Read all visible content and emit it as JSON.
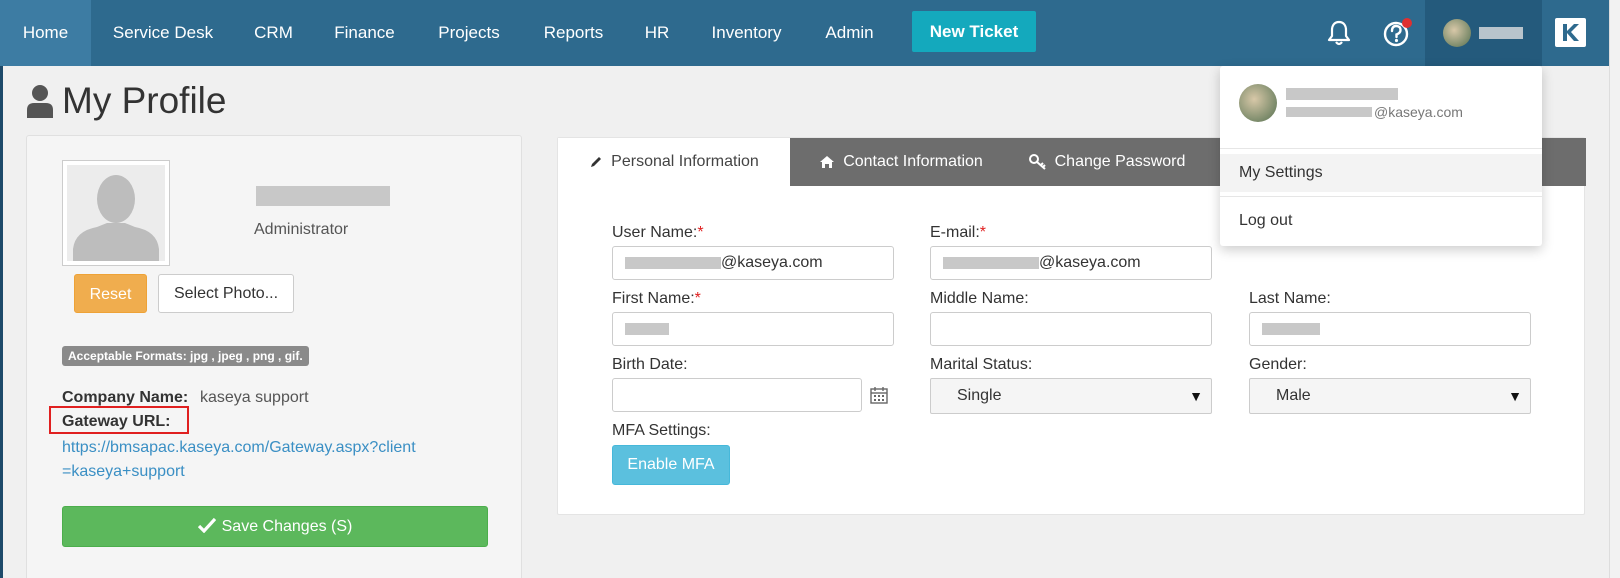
{
  "nav": {
    "items": [
      {
        "label": "Home"
      },
      {
        "label": "Service Desk"
      },
      {
        "label": "CRM"
      },
      {
        "label": "Finance"
      },
      {
        "label": "Projects"
      },
      {
        "label": "Reports"
      },
      {
        "label": "HR"
      },
      {
        "label": "Inventory"
      },
      {
        "label": "Admin"
      }
    ],
    "new_ticket": "New Ticket",
    "icons": [
      "bell-icon",
      "help-icon",
      "user-avatar",
      "kaseya-logo-icon"
    ],
    "colors": {
      "bar": "#2e6a8e",
      "active": "#3d7ca3",
      "new_ticket": "#14a9bd",
      "notification_dot": "#e03030"
    }
  },
  "page": {
    "title": "My Profile",
    "title_icon": "user-icon"
  },
  "profile": {
    "role": "Administrator",
    "reset_label": "Reset",
    "select_photo_label": "Select Photo...",
    "formats": "Acceptable Formats: jpg , jpeg , png , gif.",
    "company_label": "Company Name:",
    "company_value": "kaseya support",
    "gateway_label": "Gateway URL:",
    "gateway_url": "https://bmsapac.kaseya.com/Gateway.aspx?client=kaseya+support",
    "save_label": "Save Changes (S)",
    "save_icon": "checkmark-icon"
  },
  "tabs": [
    {
      "label": "Personal Information",
      "icon": "pencil-icon"
    },
    {
      "label": "Contact Information",
      "icon": "home-icon"
    },
    {
      "label": "Change Password",
      "icon": "key-icon"
    }
  ],
  "form": {
    "user_name_label": "User Name:",
    "user_name_suffix": "@kaseya.com",
    "email_label": "E-mail:",
    "email_suffix": "@kaseya.com",
    "required_mark": "*",
    "first_name_label": "First Name:",
    "middle_name_label": "Middle Name:",
    "last_name_label": "Last Name:",
    "birth_date_label": "Birth Date:",
    "marital_status_label": "Marital Status:",
    "marital_status_value": "Single",
    "gender_label": "Gender:",
    "gender_value": "Male",
    "mfa_label": "MFA Settings:",
    "mfa_button": "Enable MFA"
  },
  "dropdown": {
    "email_suffix": "@kaseya.com",
    "items": [
      {
        "label": "My Settings"
      },
      {
        "label": "Log out"
      }
    ]
  }
}
